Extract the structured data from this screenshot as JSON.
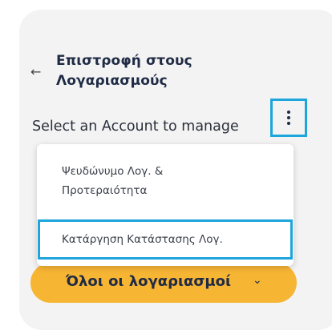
{
  "back_link": {
    "label": "Επιστροφή στους\nΛογαριασμούς",
    "line1": "Επιστροφή στους",
    "line2": "Λογαριασμούς",
    "icon": "arrow-left-icon"
  },
  "header": {
    "select_label": "Select an Account to manage",
    "more_icon": "kebab-menu-icon"
  },
  "menu": {
    "items": [
      {
        "line1": "Ψευδώνυμο Λογ. &",
        "line2": "Προτεραιότητα"
      },
      {
        "label": "Κατάργηση Κατάστασης Λογ."
      }
    ]
  },
  "accounts_dropdown": {
    "label": "Όλοι οι λογαριασμοί",
    "chevron_icon": "chevron-down-icon"
  },
  "colors": {
    "accent": "#f7b534",
    "highlight": "#1ea5dc",
    "text": "#1f2a44"
  }
}
